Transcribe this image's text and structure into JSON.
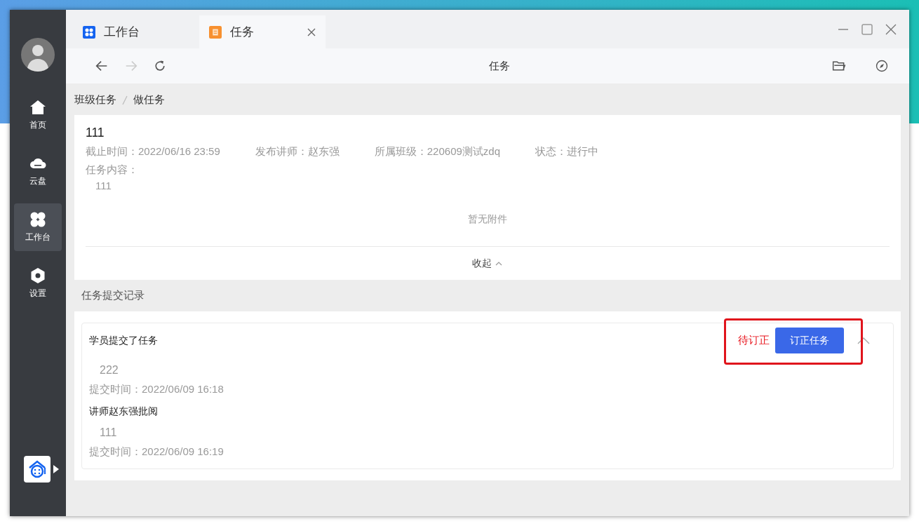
{
  "tabs": [
    {
      "label": "工作台",
      "kind": "workbench",
      "selected": false
    },
    {
      "label": "任务",
      "kind": "task",
      "selected": true
    }
  ],
  "page_title": "任务",
  "sidebar": [
    {
      "label": "首页",
      "kind": "home",
      "selected": false
    },
    {
      "label": "云盘",
      "kind": "cloud",
      "selected": false
    },
    {
      "label": "工作台",
      "kind": "workbench",
      "selected": true
    },
    {
      "label": "设置",
      "kind": "settings",
      "selected": false
    }
  ],
  "breadcrumb": [
    "班级任务",
    "做任务"
  ],
  "task": {
    "title": "111",
    "meta": [
      "截止时间：2022/06/16 23:59",
      "发布讲师：赵东强",
      "所属班级：220609测试zdq",
      "状态：进行中"
    ],
    "content_label": "任务内容：",
    "content": "111",
    "attachments": "暂无附件",
    "collapse": "收起",
    "expanded": true
  },
  "records_title": "任务提交记录",
  "record": {
    "status": "待订正",
    "action": "订正任务",
    "expanded": true,
    "highlighted": true,
    "entries": [
      {
        "heading": "学员提交了任务",
        "content": "222",
        "time": "提交时间：2022/06/09 16:18"
      },
      {
        "heading": "讲师赵东强批阅",
        "content": "111",
        "time": "提交时间：2022/06/09 16:19"
      }
    ]
  }
}
